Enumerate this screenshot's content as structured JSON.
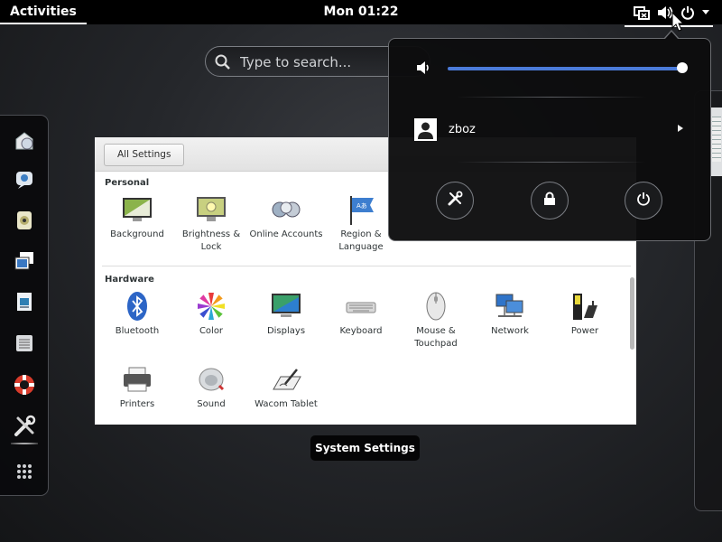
{
  "topbar": {
    "activities_label": "Activities",
    "clock": "Mon 01:22",
    "tray_icons": [
      "network-wired-icon",
      "volume-icon",
      "power-icon",
      "chevron-down-icon"
    ]
  },
  "search": {
    "placeholder": "Type to search..."
  },
  "dash": {
    "apps": [
      "web-browser-icon",
      "chat-icon",
      "music-player-icon",
      "shotwell-photos-icon",
      "document-viewer-icon",
      "file-manager-icon",
      "help-lifebuoy-icon",
      "system-settings-icon",
      "show-applications-icon"
    ]
  },
  "settings_window": {
    "toolbar_button": "All Settings",
    "sections": [
      {
        "title": "Personal",
        "items": [
          {
            "label": "Background",
            "icon": "background-icon"
          },
          {
            "label": "Brightness & Lock",
            "icon": "brightness-lock-icon"
          },
          {
            "label": "Online Accounts",
            "icon": "online-accounts-icon"
          },
          {
            "label": "Region & Language",
            "icon": "region-language-icon"
          }
        ]
      },
      {
        "title": "Hardware",
        "items": [
          {
            "label": "Bluetooth",
            "icon": "bluetooth-icon"
          },
          {
            "label": "Color",
            "icon": "color-icon"
          },
          {
            "label": "Displays",
            "icon": "displays-icon"
          },
          {
            "label": "Keyboard",
            "icon": "keyboard-icon"
          },
          {
            "label": "Mouse & Touchpad",
            "icon": "mouse-icon"
          },
          {
            "label": "Network",
            "icon": "network-icon"
          },
          {
            "label": "Power",
            "icon": "power-battery-icon"
          },
          {
            "label": "Printers",
            "icon": "printer-icon"
          },
          {
            "label": "Sound",
            "icon": "sound-icon"
          },
          {
            "label": "Wacom Tablet",
            "icon": "wacom-tablet-icon"
          }
        ]
      }
    ]
  },
  "window_label": "System Settings",
  "system_menu": {
    "volume_level": 1.0,
    "username": "zboz",
    "buttons": [
      "settings-icon",
      "lock-icon",
      "power-off-icon"
    ]
  },
  "colors": {
    "accent": "#4b7bd9",
    "panel": "#000000"
  }
}
